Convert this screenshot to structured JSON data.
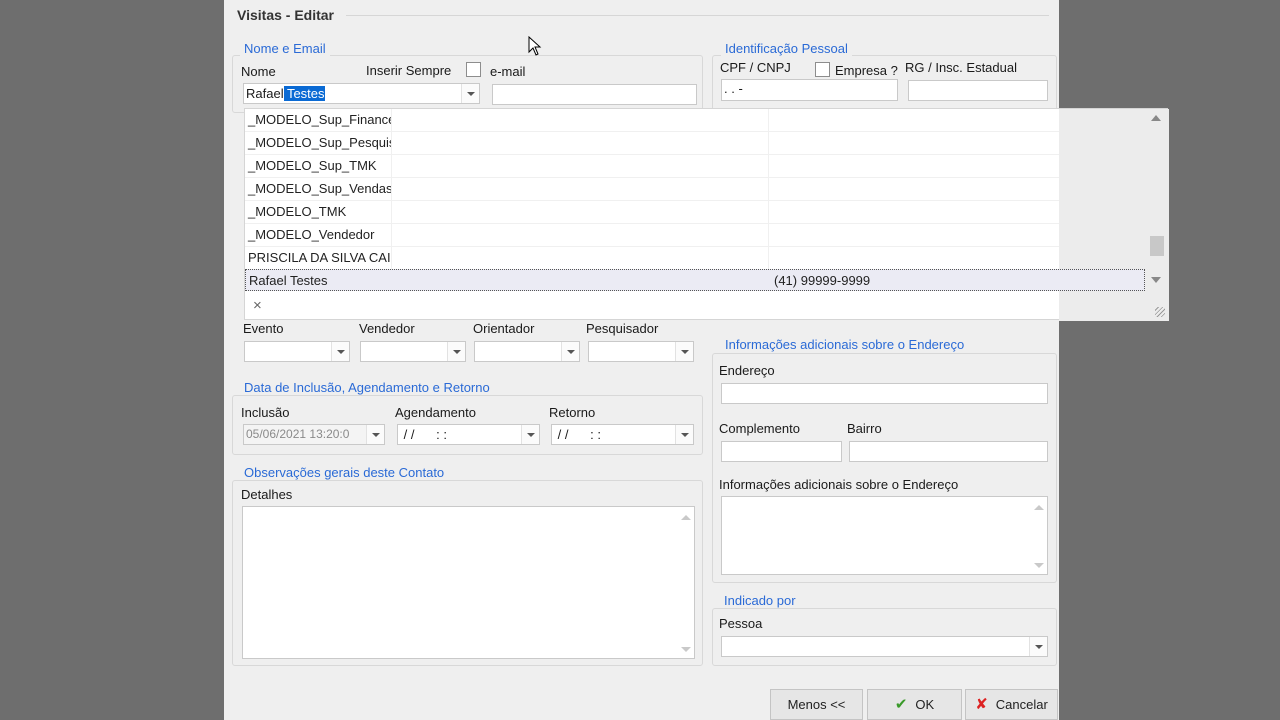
{
  "dialog": {
    "title": "Visitas - Editar"
  },
  "nome_email": {
    "group_title": "Nome e Email",
    "nome_label": "Nome",
    "inserir_sempre_label": "Inserir Sempre",
    "email_label": "e-mail",
    "nome_value_plain": "Rafael",
    "nome_value_selected": " Testes",
    "email_value": ""
  },
  "identificacao": {
    "group_title": "Identificação Pessoal",
    "cpf_label": "CPF / CNPJ",
    "empresa_label": "Empresa ?",
    "rg_label": "RG / Insc. Estadual",
    "cpf_value": " .  .  -",
    "rg_value": ""
  },
  "dropdown": {
    "rows": [
      {
        "name": "_MODELO_Sup_Finance",
        "phone": ""
      },
      {
        "name": "_MODELO_Sup_Pesquis",
        "phone": ""
      },
      {
        "name": "_MODELO_Sup_TMK",
        "phone": ""
      },
      {
        "name": "_MODELO_Sup_Vendas",
        "phone": ""
      },
      {
        "name": "_MODELO_TMK",
        "phone": ""
      },
      {
        "name": "_MODELO_Vendedor",
        "phone": ""
      },
      {
        "name": "PRISCILA DA SILVA CAI",
        "phone": ""
      },
      {
        "name": "Rafael Testes",
        "phone": "(41) 99999-9999"
      }
    ],
    "close_glyph": "×"
  },
  "pessoas": {
    "evento_label": "Evento",
    "vendedor_label": "Vendedor",
    "orientador_label": "Orientador",
    "pesquisador_label": "Pesquisador"
  },
  "datas": {
    "group_title": "Data de Inclusão, Agendamento e Retorno",
    "inclusao_label": "Inclusão",
    "agendamento_label": "Agendamento",
    "retorno_label": "Retorno",
    "inclusao_value": "05/06/2021 13:20:0",
    "agendamento_value": " / /      : :",
    "retorno_value": " / /      : :"
  },
  "observacoes": {
    "group_title": "Observações gerais deste Contato",
    "detalhes_label": "Detalhes"
  },
  "endereco": {
    "group_title": "Informações adicionais sobre o Endereço",
    "endereco_label": "Endereço",
    "complemento_label": "Complemento",
    "bairro_label": "Bairro",
    "info_label": "Informações adicionais sobre o Endereço"
  },
  "indicado": {
    "group_title": "Indicado por",
    "pessoa_label": "Pessoa"
  },
  "buttons": {
    "menos": "Menos <<",
    "ok": "OK",
    "cancelar": "Cancelar"
  }
}
